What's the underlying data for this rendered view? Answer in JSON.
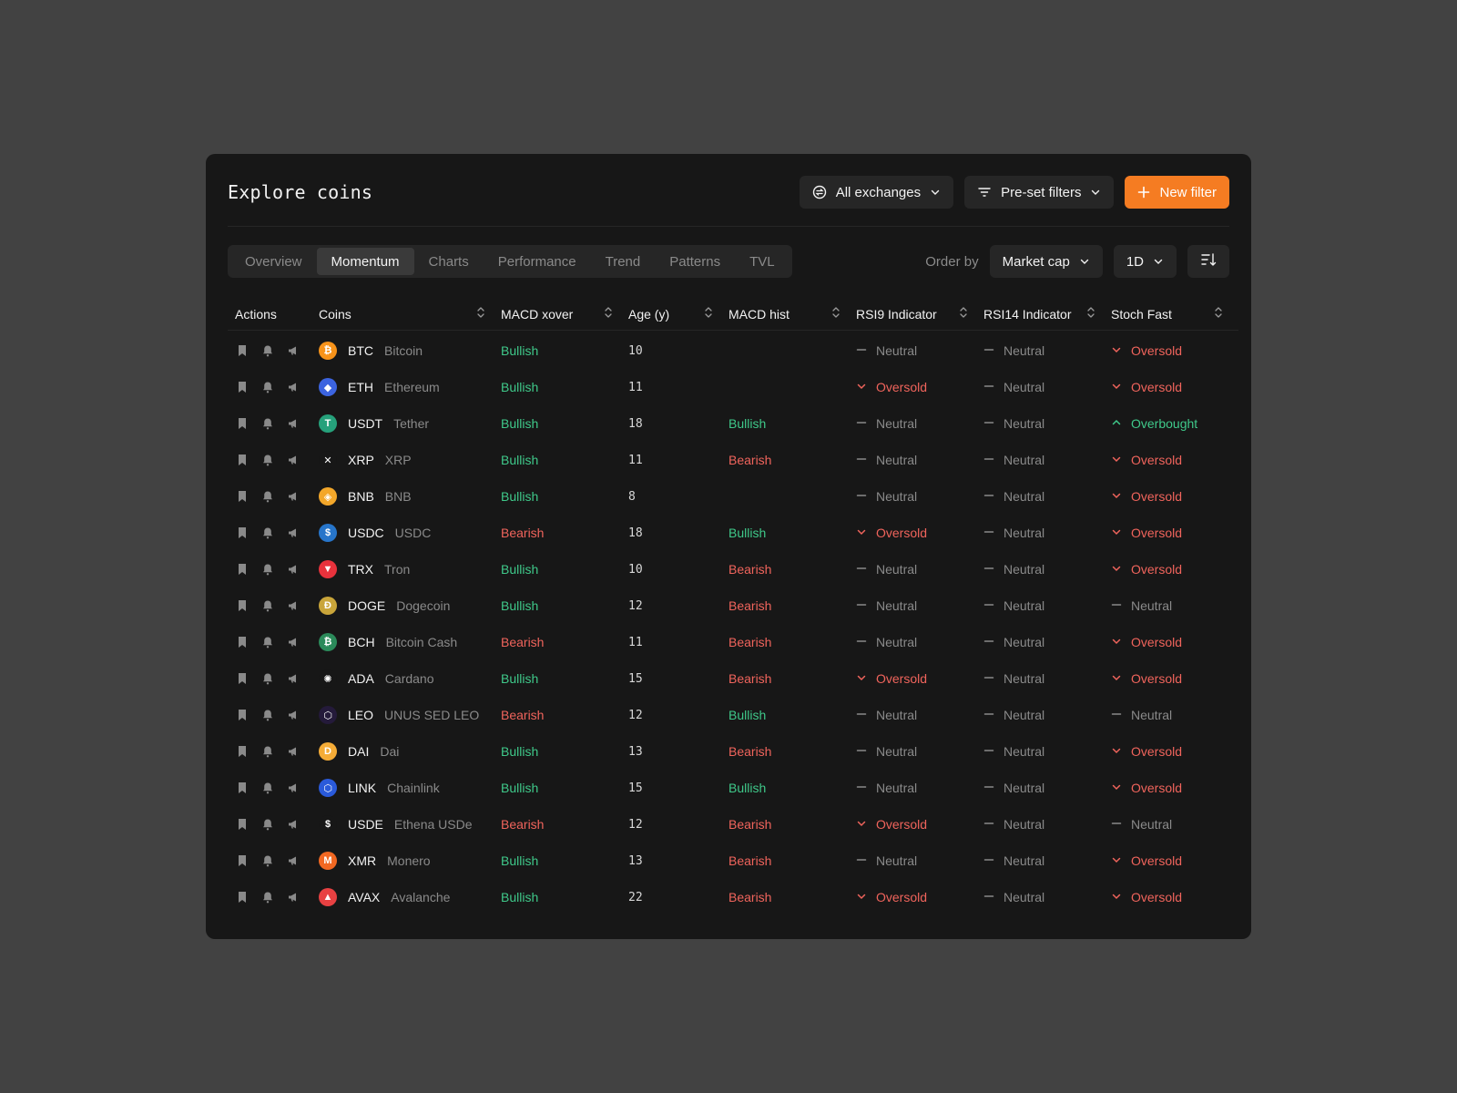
{
  "header": {
    "title": "Explore coins",
    "exchanges_label": "All exchanges",
    "presets_label": "Pre-set filters",
    "new_filter_label": "New filter"
  },
  "tabs": [
    "Overview",
    "Momentum",
    "Charts",
    "Performance",
    "Trend",
    "Patterns",
    "TVL"
  ],
  "active_tab": "Momentum",
  "order": {
    "label": "Order by",
    "value": "Market cap",
    "period": "1D"
  },
  "columns": [
    "Actions",
    "Coins",
    "MACD xover",
    "Age (y)",
    "MACD hist",
    "RSI9 Indicator",
    "RSI14 Indicator",
    "Stoch Fast"
  ],
  "colors": {
    "accent": "#f57c22",
    "bullish": "#3fc98a",
    "bearish": "#f0645c",
    "neutral": "#8a8a8a"
  },
  "rows": [
    {
      "symbol": "BTC",
      "name": "Bitcoin",
      "logo_color": "#f7931a",
      "logo_glyph": "₿",
      "xover": "Bullish",
      "age": "10",
      "hist": "",
      "rsi9": "Neutral",
      "rsi14": "Neutral",
      "stoch": "Oversold"
    },
    {
      "symbol": "ETH",
      "name": "Ethereum",
      "logo_color": "#3c64e0",
      "logo_glyph": "◆",
      "xover": "Bullish",
      "age": "11",
      "hist": "",
      "rsi9": "Oversold",
      "rsi14": "Neutral",
      "stoch": "Oversold"
    },
    {
      "symbol": "USDT",
      "name": "Tether",
      "logo_color": "#26a17b",
      "logo_glyph": "T",
      "xover": "Bullish",
      "age": "18",
      "hist": "Bullish",
      "rsi9": "Neutral",
      "rsi14": "Neutral",
      "stoch": "Overbought"
    },
    {
      "symbol": "XRP",
      "name": "XRP",
      "logo_color": "#171717",
      "logo_glyph": "✕",
      "xover": "Bullish",
      "age": "11",
      "hist": "Bearish",
      "rsi9": "Neutral",
      "rsi14": "Neutral",
      "stoch": "Oversold"
    },
    {
      "symbol": "BNB",
      "name": "BNB",
      "logo_color": "#f3a72a",
      "logo_glyph": "◈",
      "xover": "Bullish",
      "age": "8",
      "hist": "",
      "rsi9": "Neutral",
      "rsi14": "Neutral",
      "stoch": "Oversold"
    },
    {
      "symbol": "USDC",
      "name": "USDC",
      "logo_color": "#2775ca",
      "logo_glyph": "$",
      "xover": "Bearish",
      "age": "18",
      "hist": "Bullish",
      "rsi9": "Oversold",
      "rsi14": "Neutral",
      "stoch": "Oversold"
    },
    {
      "symbol": "TRX",
      "name": "Tron",
      "logo_color": "#e8323c",
      "logo_glyph": "▼",
      "xover": "Bullish",
      "age": "10",
      "hist": "Bearish",
      "rsi9": "Neutral",
      "rsi14": "Neutral",
      "stoch": "Oversold"
    },
    {
      "symbol": "DOGE",
      "name": "Dogecoin",
      "logo_color": "#c9a53a",
      "logo_glyph": "Ð",
      "xover": "Bullish",
      "age": "12",
      "hist": "Bearish",
      "rsi9": "Neutral",
      "rsi14": "Neutral",
      "stoch": "Neutral"
    },
    {
      "symbol": "BCH",
      "name": "Bitcoin Cash",
      "logo_color": "#2b8a5a",
      "logo_glyph": "₿",
      "xover": "Bearish",
      "age": "11",
      "hist": "Bearish",
      "rsi9": "Neutral",
      "rsi14": "Neutral",
      "stoch": "Oversold"
    },
    {
      "symbol": "ADA",
      "name": "Cardano",
      "logo_color": "#171717",
      "logo_glyph": "✺",
      "xover": "Bullish",
      "age": "15",
      "hist": "Bearish",
      "rsi9": "Oversold",
      "rsi14": "Neutral",
      "stoch": "Oversold"
    },
    {
      "symbol": "LEO",
      "name": "UNUS SED LEO",
      "logo_color": "#241a3a",
      "logo_glyph": "⬡",
      "xover": "Bearish",
      "age": "12",
      "hist": "Bullish",
      "rsi9": "Neutral",
      "rsi14": "Neutral",
      "stoch": "Neutral"
    },
    {
      "symbol": "DAI",
      "name": "Dai",
      "logo_color": "#f5ac37",
      "logo_glyph": "D",
      "xover": "Bullish",
      "age": "13",
      "hist": "Bearish",
      "rsi9": "Neutral",
      "rsi14": "Neutral",
      "stoch": "Oversold"
    },
    {
      "symbol": "LINK",
      "name": "Chainlink",
      "logo_color": "#2a5ada",
      "logo_glyph": "⬡",
      "xover": "Bullish",
      "age": "15",
      "hist": "Bullish",
      "rsi9": "Neutral",
      "rsi14": "Neutral",
      "stoch": "Oversold"
    },
    {
      "symbol": "USDE",
      "name": "Ethena USDe",
      "logo_color": "#171717",
      "logo_glyph": "$",
      "xover": "Bearish",
      "age": "12",
      "hist": "Bearish",
      "rsi9": "Oversold",
      "rsi14": "Neutral",
      "stoch": "Neutral"
    },
    {
      "symbol": "XMR",
      "name": "Monero",
      "logo_color": "#f26822",
      "logo_glyph": "M",
      "xover": "Bullish",
      "age": "13",
      "hist": "Bearish",
      "rsi9": "Neutral",
      "rsi14": "Neutral",
      "stoch": "Oversold"
    },
    {
      "symbol": "AVAX",
      "name": "Avalanche",
      "logo_color": "#e84142",
      "logo_glyph": "▲",
      "xover": "Bullish",
      "age": "22",
      "hist": "Bearish",
      "rsi9": "Oversold",
      "rsi14": "Neutral",
      "stoch": "Oversold"
    }
  ]
}
